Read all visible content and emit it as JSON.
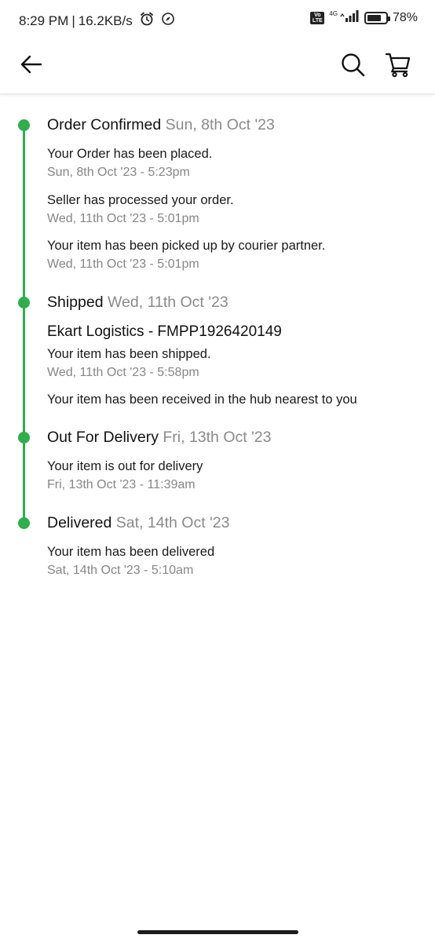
{
  "status_bar": {
    "time": "8:29 PM",
    "speed": "16.2KB/s",
    "network": "4G",
    "volte": "Vo LTE",
    "battery": "78%",
    "battery_level": 0.78
  },
  "header": {
    "back_icon": "arrow-left-icon",
    "search_icon": "search-icon",
    "cart_icon": "cart-icon"
  },
  "accent_color": "#2eae4c",
  "timeline": [
    {
      "title": "Order Confirmed",
      "date": "Sun, 8th Oct '23",
      "events": [
        {
          "text": "Your Order has been placed.",
          "time": "Sun, 8th Oct '23 - 5:23pm"
        },
        {
          "text": "Seller has processed your order.",
          "time": "Wed, 11th Oct '23 - 5:01pm"
        },
        {
          "text": "Your item has been picked up by courier partner.",
          "time": "Wed, 11th Oct '23 - 5:01pm"
        }
      ]
    },
    {
      "title": "Shipped",
      "date": "Wed, 11th Oct '23",
      "courier": "Ekart Logistics - FMPP1926420149",
      "events": [
        {
          "text": "Your item has been shipped.",
          "time": "Wed, 11th Oct '23 - 5:58pm"
        },
        {
          "text": "Your item has been received in the hub nearest to you",
          "time": ""
        }
      ]
    },
    {
      "title": "Out For Delivery",
      "date": "Fri, 13th Oct '23",
      "events": [
        {
          "text": "Your item is out for delivery",
          "time": "Fri, 13th Oct '23 - 11:39am"
        }
      ]
    },
    {
      "title": "Delivered",
      "date": "Sat, 14th Oct '23",
      "events": [
        {
          "text": "Your item has been delivered",
          "time": "Sat, 14th Oct '23 - 5:10am"
        }
      ]
    }
  ]
}
